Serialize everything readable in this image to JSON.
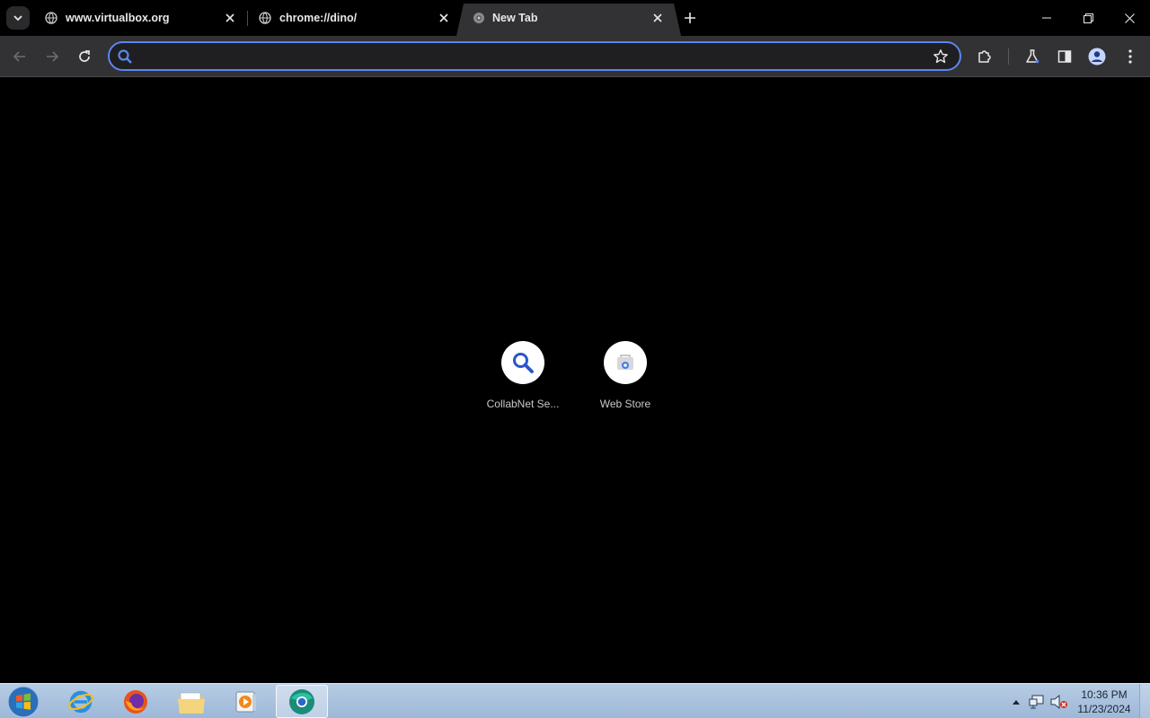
{
  "tabs": [
    {
      "title": "www.virtualbox.org",
      "active": false
    },
    {
      "title": "chrome://dino/",
      "active": false
    },
    {
      "title": "New Tab",
      "active": true
    }
  ],
  "omnibox": {
    "value": "",
    "placeholder": ""
  },
  "shortcuts": [
    {
      "label": "CollabNet Se...",
      "icon": "search-icon"
    },
    {
      "label": "Web Store",
      "icon": "web-store-icon"
    }
  ],
  "taskbar": {
    "apps": [
      "internet-explorer-icon",
      "firefox-icon",
      "file-explorer-icon",
      "media-player-icon",
      "chrome-canary-icon"
    ],
    "clock_time": "10:36 PM",
    "clock_date": "11/23/2024"
  },
  "colors": {
    "accent": "#5b86f0",
    "toolbar": "#323234",
    "background": "#000000"
  }
}
